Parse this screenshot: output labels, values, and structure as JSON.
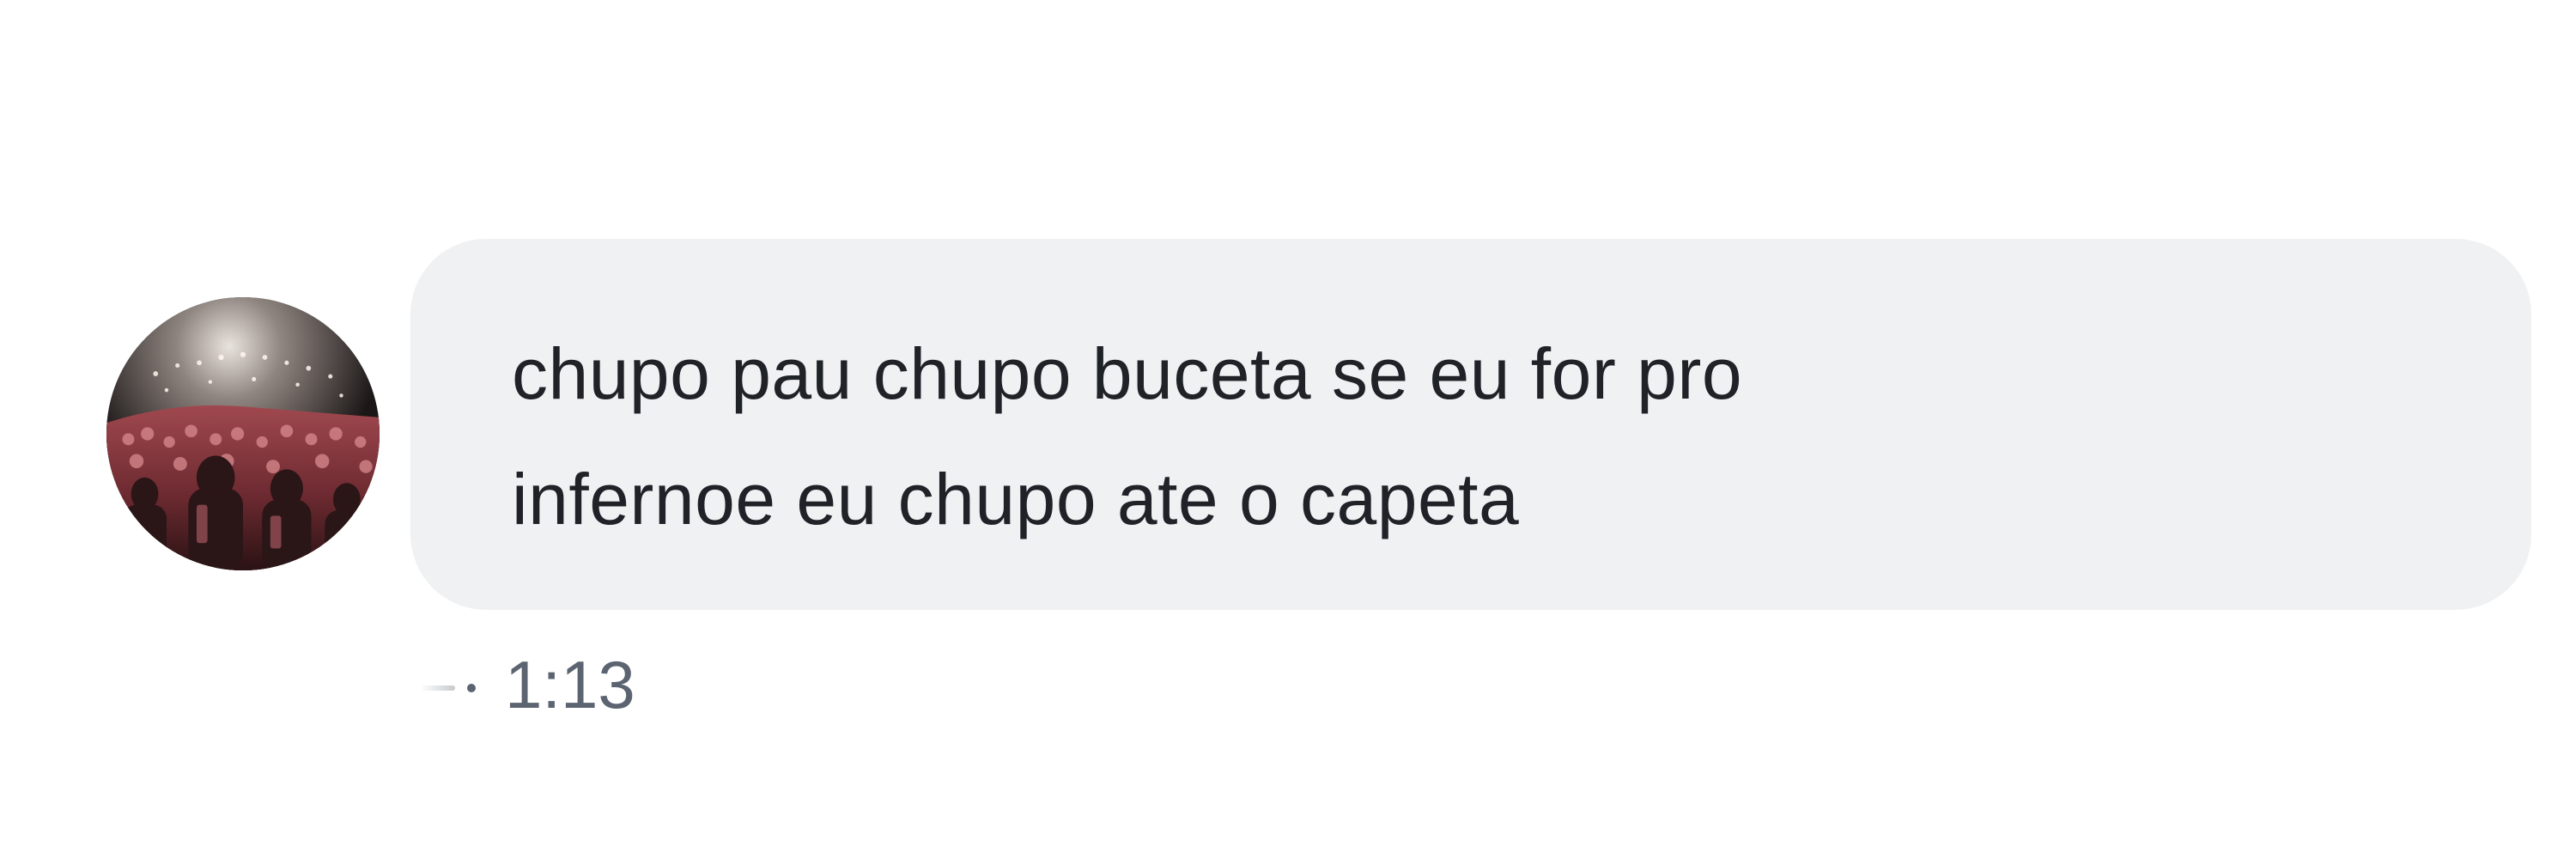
{
  "message": {
    "lines": [
      "chupo pau chupo buceta se eu for pro",
      "infernoe eu chupo ate o capeta"
    ],
    "time": "1:13"
  },
  "avatar": {
    "icon": "concert-crowd-avatar"
  },
  "colors": {
    "bubble": "#eff1f3",
    "text": "#1f2328",
    "meta": "#5b6470",
    "background": "#ffffff"
  }
}
